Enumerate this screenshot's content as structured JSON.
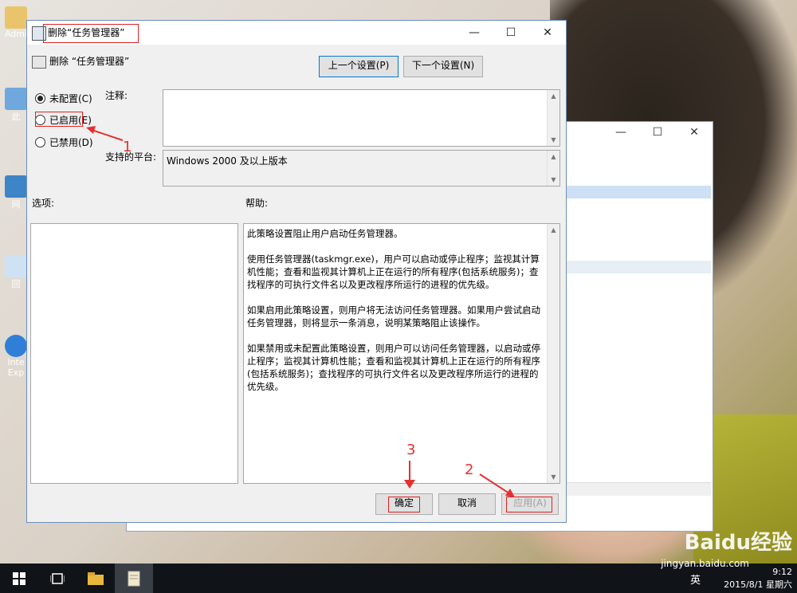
{
  "dialog": {
    "title": "删除“任务管理器”",
    "header_title": "删除 “任务管理器”",
    "prev_setting": "上一个设置(P)",
    "next_setting": "下一个设置(N)",
    "radio_not_configured": "未配置(C)",
    "radio_enabled": "已启用(E)",
    "radio_disabled": "已禁用(D)",
    "selected_radio": "not_configured",
    "comment_label": "注释:",
    "comment_value": "",
    "supported_label": "支持的平台:",
    "supported_value": "Windows 2000 及以上版本",
    "options_label": "选项:",
    "help_label": "帮助:",
    "help_paragraphs": [
      "此策略设置阻止用户启动任务管理器。",
      "使用任务管理器(taskmgr.exe)，用户可以启动或停止程序；监视其计算机性能；查看和监视其计算机上正在运行的所有程序(包括系统服务)；查找程序的可执行文件名以及更改程序所运行的进程的优先级。",
      "如果启用此策略设置，则用户将无法访问任务管理器。如果用户尝试启动任务管理器，则将显示一条消息，说明某策略阻止该操作。",
      "如果禁用或未配置此策略设置，则用户可以访问任务管理器，以启动或停止程序；监视其计算机性能；查看和监视其计算机上正在运行的所有程序(包括系统服务)；查找程序的可执行文件名以及更改程序所运行的进程的优先级。"
    ],
    "ok_label": "确定",
    "cancel_label": "取消",
    "apply_label": "应用(A)"
  },
  "window_controls": {
    "minimize": "—",
    "maximize": "☐",
    "close": "✕"
  },
  "annotations": {
    "step1": "1",
    "step2": "2",
    "step3": "3"
  },
  "desktop_icons": [
    {
      "label": "Admi",
      "icon": "user-folder-icon"
    },
    {
      "label": "此",
      "icon": "computer-icon"
    },
    {
      "label": "网",
      "icon": "network-icon"
    },
    {
      "label": "回",
      "icon": "recycle-bin-icon"
    },
    {
      "label": "Inte\nExp",
      "icon": "internet-explorer-icon"
    }
  ],
  "taskbar": {
    "time": "9:12",
    "date": "2015/8/1 星期六",
    "ime": "英",
    "icons": [
      "windows-start-icon",
      "task-view-icon",
      "file-explorer-icon",
      "notepad-icon"
    ]
  },
  "watermark": {
    "brand": "Baidu经验",
    "url": "jingyan.baidu.com"
  },
  "colors": {
    "accent": "#0078d7",
    "annotation_red": "#e02020",
    "taskbar": "#101418"
  }
}
